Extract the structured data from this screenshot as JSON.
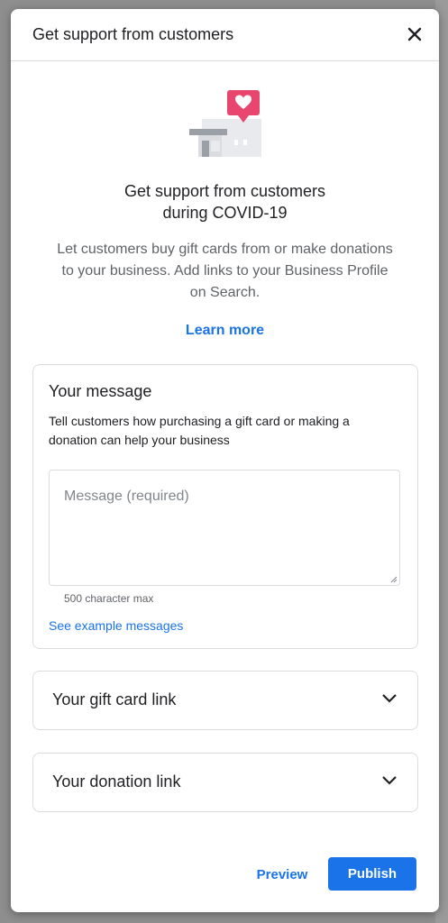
{
  "dialog": {
    "title": "Get support from customers",
    "close_icon": "close-icon"
  },
  "hero": {
    "illustration_icon": "storefront-heart-icon",
    "headline_line1": "Get support from customers",
    "headline_line2": "during COVID-19",
    "description": "Let customers buy gift cards from or make donations to your business. Add links to your Business Profile on Search.",
    "learn_more": "Learn more"
  },
  "message_card": {
    "title": "Your message",
    "subtitle": "Tell customers how purchasing a gift card or making a donation can help your business",
    "placeholder": "Message (required)",
    "value": "",
    "char_limit": "500 character max",
    "examples_link": "See example messages"
  },
  "gift_card": {
    "label": "Your gift card link",
    "icon": "chevron-down-icon"
  },
  "donation": {
    "label": "Your donation link",
    "icon": "chevron-down-icon"
  },
  "actions": {
    "preview": "Preview",
    "publish": "Publish"
  },
  "colors": {
    "accent": "#1a73e8",
    "heart_badge": "#e8456f",
    "backdrop": "#8e8e8e"
  }
}
